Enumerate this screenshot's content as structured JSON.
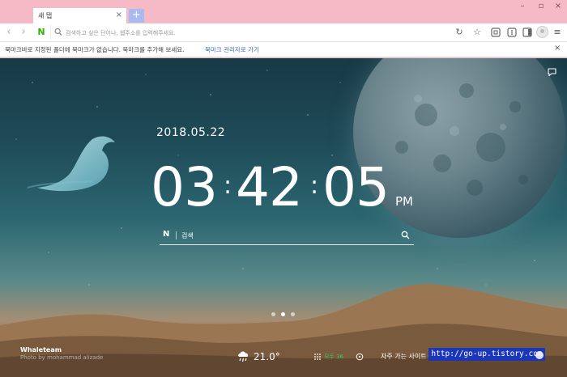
{
  "tab": {
    "title": "새 탭"
  },
  "address_bar": {
    "placeholder": "검색하고 싶은 단어나, 웹주소를 입력해주세요.",
    "value": ""
  },
  "bookmark_bar": {
    "message": "북마크바로 지정된 폴더에 북마크가 없습니다. 북마크를 추가해 보세요.",
    "link": "북마크 관리자로 가기"
  },
  "ntp": {
    "date": "2018.05.22",
    "clock": {
      "hours": "03",
      "minutes": "42",
      "seconds": "05",
      "ampm": "PM",
      "separator": ":"
    },
    "search": {
      "brand": "N",
      "placeholder": "검색"
    },
    "credit": {
      "title": "Whaleteam",
      "photographer": "Photo by mohammad alizade"
    },
    "weather": {
      "temperature": "21.0°",
      "icon": "rain-cloud-icon"
    },
    "apps": {
      "count_label": "모두 36"
    },
    "frequent_sites_label": "자주 가는 사이트",
    "watermark": "http://go-up.tistory.com"
  },
  "colors": {
    "titlebar": "#f5bac5",
    "newtab_button": "#a9b9f2",
    "naver_green": "#2db400",
    "link": "#3c6cc6",
    "watermark_bg": "#1b36b8"
  }
}
